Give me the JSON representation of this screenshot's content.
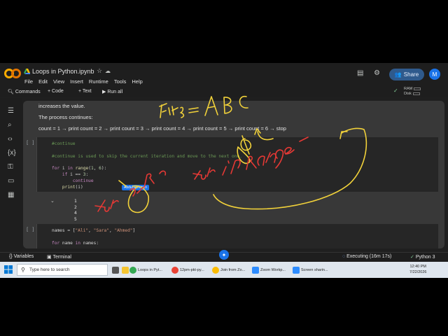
{
  "header": {
    "notebook_title": "Loops in Python.ipynb",
    "menu": [
      "File",
      "Edit",
      "View",
      "Insert",
      "Runtime",
      "Tools",
      "Help"
    ],
    "share_label": "Share",
    "avatar_initial": "M"
  },
  "toolbar": {
    "commands_label": "Commands",
    "code_label": "+ Code",
    "text_label": "+ Text",
    "run_all_label": "Run all",
    "ram_label": "RAM",
    "disk_label": "Disk"
  },
  "notebook": {
    "text_line_1": "increases the value.",
    "text_line_2": "The process continues:",
    "text_line_3": "count = 1 → print count = 2 → print count = 3 → print count = 4 → print count = 5 → print count = 6 → stop",
    "cell1": {
      "label": "[ ]",
      "code": [
        "#continue",
        "",
        "#continue is used to skip the current iteration and move to the next one.",
        "",
        "for i in range(1, 6):",
        "    if i == 3:",
        "        continue",
        "    print(i)"
      ],
      "output": [
        "1",
        "2",
        "4",
        "5"
      ]
    },
    "cell2": {
      "label": "[ ]",
      "code": [
        "names = [\"Ali\", \"Sara\", \"Ahmed\"]",
        "",
        "for name in names:"
      ]
    },
    "cursor_tag": "Abdul Rehman"
  },
  "statusbar": {
    "variables_label": "Variables",
    "terminal_label": "Terminal",
    "executing_label": "Executing (16m 17s)",
    "kernel_label": "Python 3"
  },
  "taskbar": {
    "search_placeholder": "Type here to search",
    "apps": [
      "Loops in Pyt...",
      "12pm-pkt-py...",
      "Join from Zo...",
      "Zoom Workp...",
      "Screen sharin..."
    ],
    "time": "12:40 PM",
    "date": "7/22/2026"
  },
  "colors": {
    "accent": "#1a73e8",
    "ink_red": "#e53935",
    "ink_yellow": "#f2d23a"
  }
}
